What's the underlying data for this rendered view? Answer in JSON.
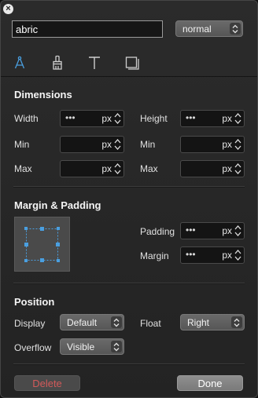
{
  "header": {
    "name_value": "abric",
    "style_select": "normal"
  },
  "tabs": [
    {
      "name": "compass-icon",
      "active": true
    },
    {
      "name": "brush-icon",
      "active": false
    },
    {
      "name": "text-icon",
      "active": false
    },
    {
      "name": "box-icon",
      "active": false
    }
  ],
  "dimensions": {
    "title": "Dimensions",
    "width_label": "Width",
    "height_label": "Height",
    "min_label": "Min",
    "max_label": "Max",
    "placeholder": "•••",
    "unit": "px"
  },
  "margin_padding": {
    "title": "Margin & Padding",
    "padding_label": "Padding",
    "margin_label": "Margin",
    "placeholder": "•••",
    "unit": "px"
  },
  "position": {
    "title": "Position",
    "display_label": "Display",
    "display_value": "Default",
    "float_label": "Float",
    "float_value": "Right",
    "overflow_label": "Overflow",
    "overflow_value": "Visible"
  },
  "footer": {
    "delete_label": "Delete",
    "done_label": "Done"
  },
  "colors": {
    "accent": "#4a9fe0",
    "delete": "#d25a5a"
  }
}
